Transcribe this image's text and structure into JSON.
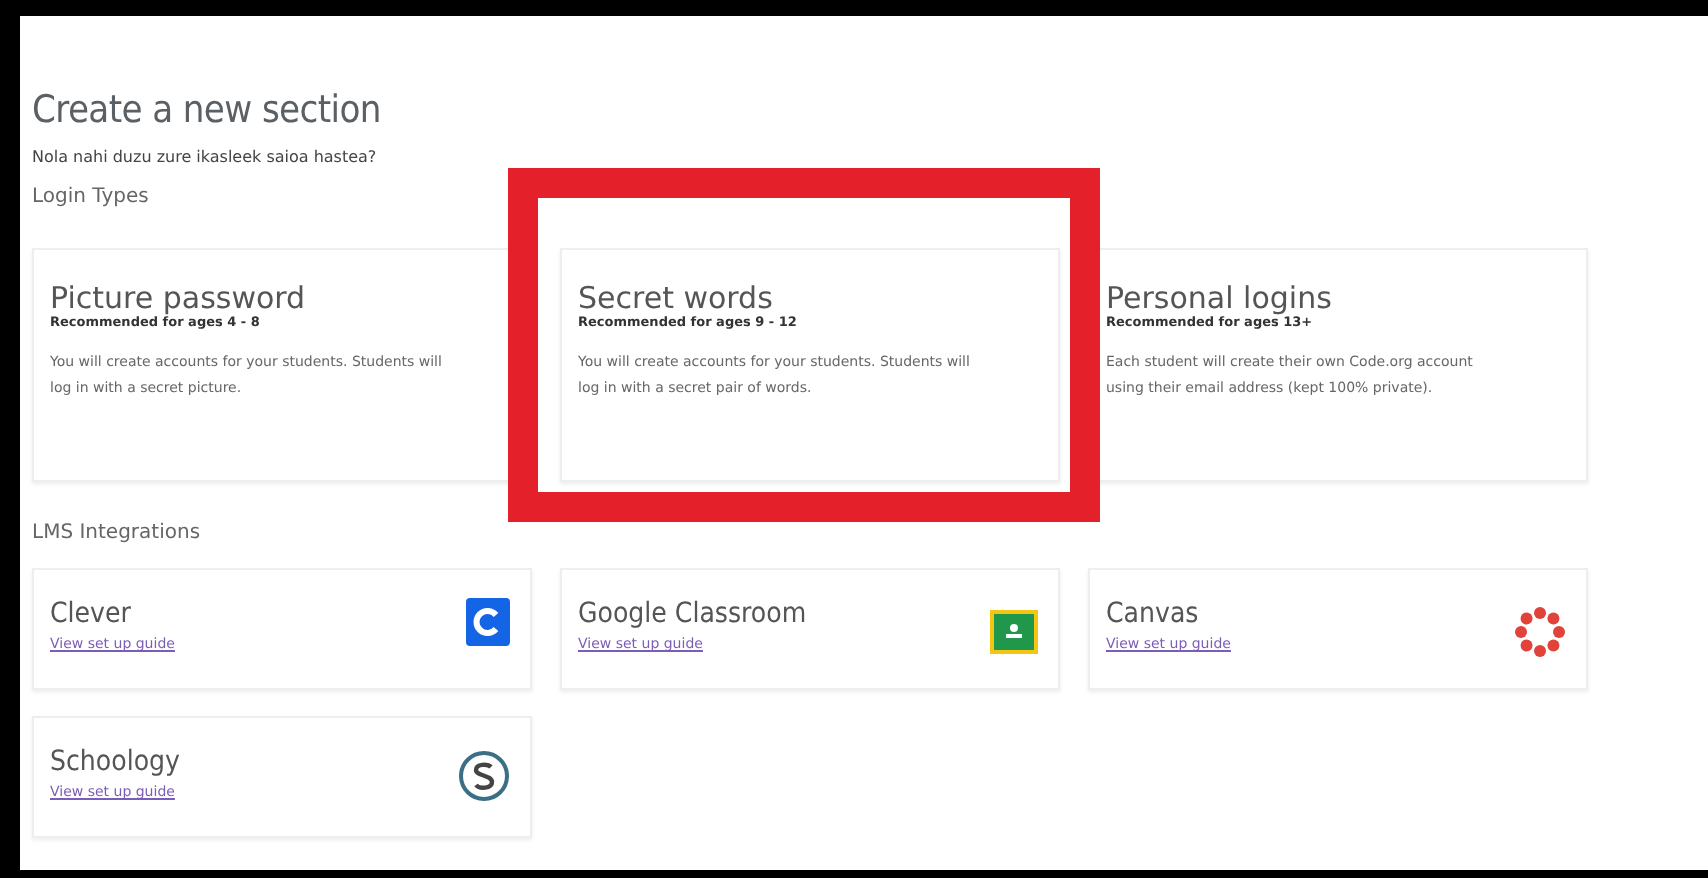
{
  "title": "Create a new section",
  "subtitle": "Nola nahi duzu zure ikasleek saioa hastea?",
  "login_types": {
    "heading": "Login Types",
    "items": [
      {
        "title": "Picture password",
        "recommendation": "Recommended for ages 4 - 8",
        "description": "You will create accounts for your students. Students will log in with a secret picture.",
        "highlighted": false
      },
      {
        "title": "Secret words",
        "recommendation": "Recommended for ages 9 - 12",
        "description": "You will create accounts for your students. Students will log in with a secret pair of words.",
        "highlighted": true
      },
      {
        "title": "Personal logins",
        "recommendation": "Recommended for ages 13+",
        "description": "Each student will create their own Code.org account using their email address (kept 100% private).",
        "highlighted": false
      }
    ]
  },
  "lms_integrations": {
    "heading": "LMS Integrations",
    "items": [
      {
        "name": "Clever",
        "link": "View set up guide",
        "kind": "clever"
      },
      {
        "name": "Google Classroom",
        "link": "View set up guide",
        "kind": "classroom"
      },
      {
        "name": "Canvas",
        "link": "View set up guide",
        "kind": "canvas"
      },
      {
        "name": "Schoology",
        "link": "View set up guide",
        "kind": "schoology"
      }
    ]
  }
}
